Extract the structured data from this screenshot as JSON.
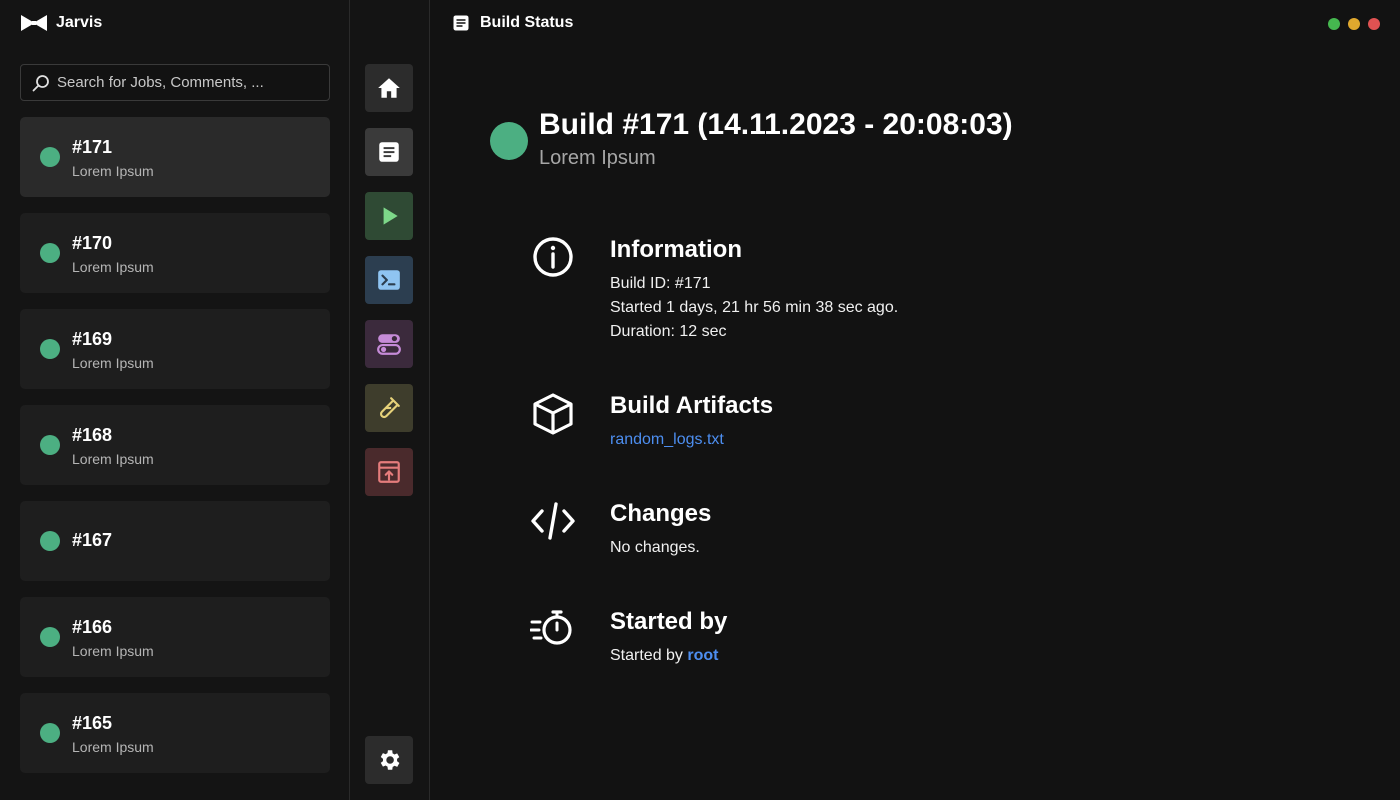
{
  "app": {
    "name": "Jarvis"
  },
  "search": {
    "placeholder": "Search for Jobs, Comments, ..."
  },
  "jobs": [
    {
      "number": "#171",
      "subtitle": "Lorem Ipsum",
      "status": "success",
      "active": true
    },
    {
      "number": "#170",
      "subtitle": "Lorem Ipsum",
      "status": "success",
      "active": false
    },
    {
      "number": "#169",
      "subtitle": "Lorem Ipsum",
      "status": "success",
      "active": false
    },
    {
      "number": "#168",
      "subtitle": "Lorem Ipsum",
      "status": "success",
      "active": false
    },
    {
      "number": "#167",
      "subtitle": "",
      "status": "success",
      "active": false
    },
    {
      "number": "#166",
      "subtitle": "Lorem Ipsum",
      "status": "success",
      "active": false
    },
    {
      "number": "#165",
      "subtitle": "Lorem Ipsum",
      "status": "success",
      "active": false
    }
  ],
  "toolbar": {
    "items": [
      {
        "icon": "home-icon",
        "bg": "#2c2c2c",
        "color": "#ffffff"
      },
      {
        "icon": "document-icon",
        "bg": "#3a3a3a",
        "color": "#ffffff"
      },
      {
        "icon": "play-icon",
        "bg": "#2f4a34",
        "color": "#7dd889"
      },
      {
        "icon": "terminal-icon",
        "bg": "#2c3e50",
        "color": "#8fc4f2"
      },
      {
        "icon": "toggle-icon",
        "bg": "#3b2a3c",
        "color": "#c68bd8"
      },
      {
        "icon": "test-tube-icon",
        "bg": "#3e3d2c",
        "color": "#e6d27a"
      },
      {
        "icon": "open-external-icon",
        "bg": "#4a2a2c",
        "color": "#e57c7c"
      }
    ],
    "settings_icon": "gear-icon"
  },
  "header": {
    "title": "Build Status",
    "icon": "document-icon"
  },
  "window_controls": {
    "colors": [
      "#45b84f",
      "#e0a82e",
      "#e05252"
    ]
  },
  "build": {
    "title": "Build #171 (14.11.2023 - 20:08:03)",
    "subtitle": "Lorem Ipsum",
    "status_color": "#4caf82"
  },
  "sections": {
    "information": {
      "title": "Information",
      "icon": "info-icon",
      "lines": [
        "Build ID: #171",
        "Started 1 days, 21 hr 56 min 38 sec ago.",
        "Duration: 12 sec"
      ]
    },
    "artifacts": {
      "title": "Build Artifacts",
      "icon": "box-icon",
      "files": [
        "random_logs.txt"
      ]
    },
    "changes": {
      "title": "Changes",
      "icon": "code-icon",
      "text": "No changes."
    },
    "started_by": {
      "title": "Started by",
      "icon": "stopwatch-icon",
      "prefix": "Started by",
      "user": "root"
    }
  },
  "colors": {
    "success": "#4caf82",
    "link": "#4d8ef0"
  }
}
